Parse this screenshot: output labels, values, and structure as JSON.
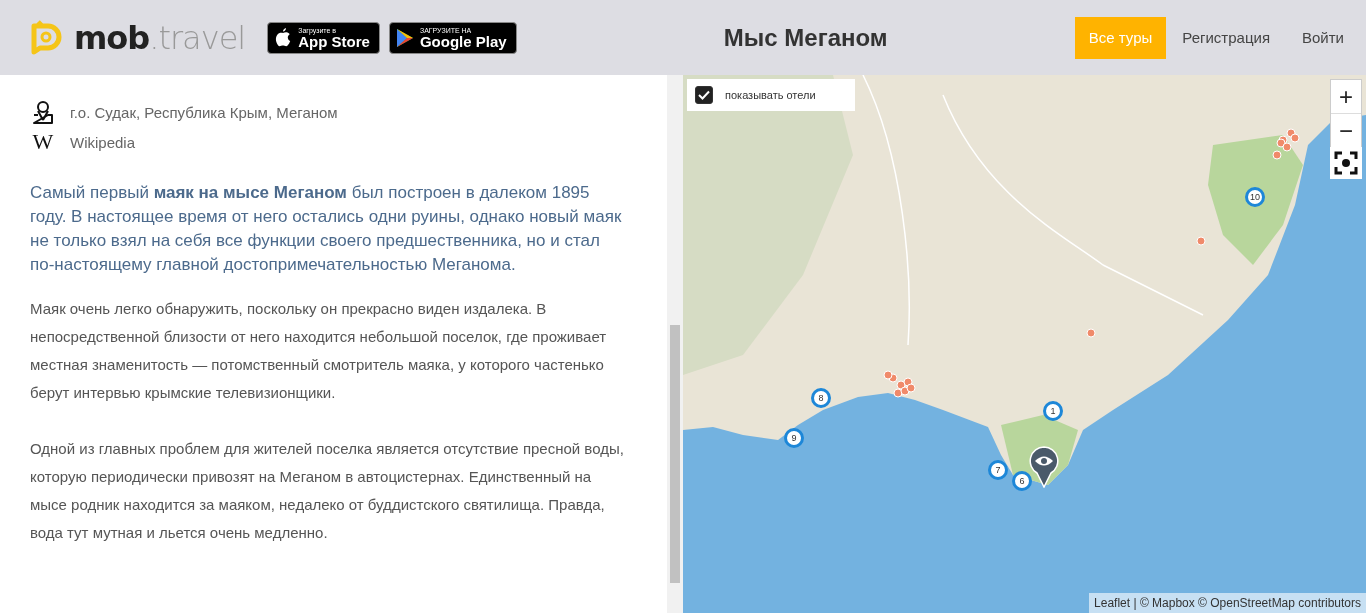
{
  "header": {
    "logo": "**mob**.travel",
    "store_badges": [
      {
        "kind": "apple",
        "top": "Загрузите в",
        "bottom": "App Store"
      },
      {
        "kind": "google",
        "top": "ЗАГРУЗИТЕ НА",
        "bottom": "Google Play"
      }
    ],
    "title": "Мыс Меганом",
    "nav": [
      {
        "label": "Все туры",
        "selected": true
      },
      {
        "label": "Регистрация",
        "selected": false
      },
      {
        "label": "Войти",
        "selected": false
      }
    ]
  },
  "info": [
    {
      "kind": "location",
      "text": "г.о. Судак, Республика Крым, Меганом"
    },
    {
      "kind": "wiki",
      "icon": "W",
      "text": "Wikipedia"
    }
  ],
  "intro": "Самый первый **маяк на мысе Меганом** был построен в далеком 1895 году. В настоящее время от него остались одни руины, однако новый маяк не только взял на себя все функции своего предшественника, но и стал по-настоящему главной достопримечательностью Меганома.",
  "paragraphs": [
    "Маяк очень легко обнаружить, поскольку он прекрасно виден издалека. В непосредственной близости от него находится небольшой поселок, где проживает местная знаменитость — потомственный смотритель маяка, у которого частенько берут интервью крымские телевизионщики.",
    "Одной из главных проблем для жителей поселка является отсутствие пресной воды, которую периодически привозят на Меганом в автоцистернах. Единственный на мысе родник находится за маяком, недалеко от буддистского святилища. Правда, вода тут мутная и льется очень медленно."
  ],
  "map": {
    "hotels_toggle": {
      "label": "показывать отели",
      "checked": true
    },
    "zoom_in": "+",
    "zoom_out": "−",
    "markers": [
      {
        "label": "8"
      },
      {
        "label": "9"
      },
      {
        "label": "1"
      },
      {
        "label": "7"
      },
      {
        "label": "6"
      },
      {
        "label": "10"
      }
    ],
    "attribution": "Leaflet | © Mapbox © OpenStreetMap contributors"
  }
}
